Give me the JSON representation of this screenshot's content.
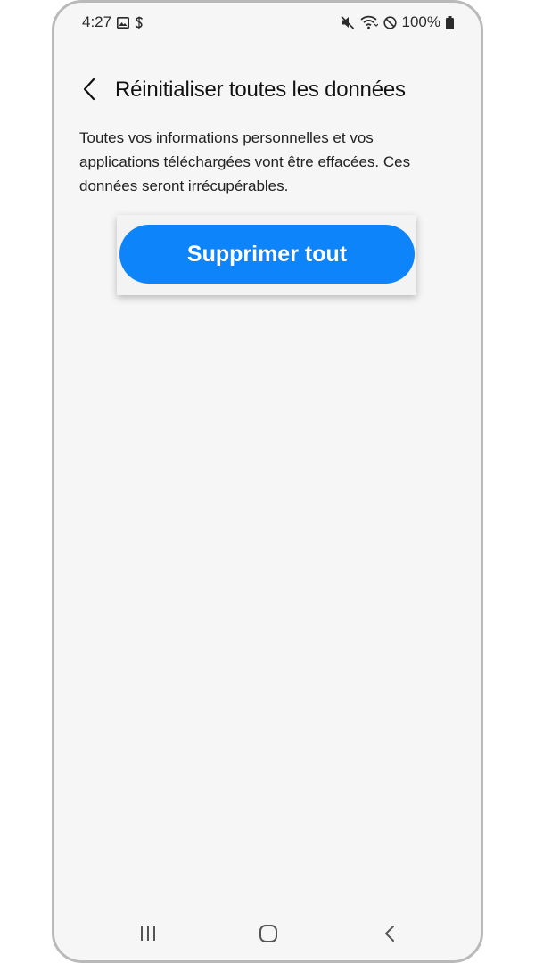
{
  "status_bar": {
    "time": "4:27",
    "battery": "100%",
    "icons_left": [
      "gallery-icon",
      "s-icon"
    ],
    "icons_right": [
      "mute-icon",
      "wifi-icon",
      "no-disturb-icon",
      "battery-icon"
    ]
  },
  "header": {
    "title": "Réinitialiser toutes les données",
    "back_icon": "chevron-left-icon"
  },
  "description": "Toutes vos informations personnelles et vos applications téléchargées vont être effacées. Ces données seront irrécupérables.",
  "actions": {
    "delete_all_label": "Supprimer tout"
  },
  "nav_bar": {
    "icons": [
      "recent-apps-icon",
      "home-icon",
      "back-icon"
    ]
  },
  "colors": {
    "accent": "#0d84fa",
    "background": "#f6f6f6",
    "text": "#111111"
  }
}
